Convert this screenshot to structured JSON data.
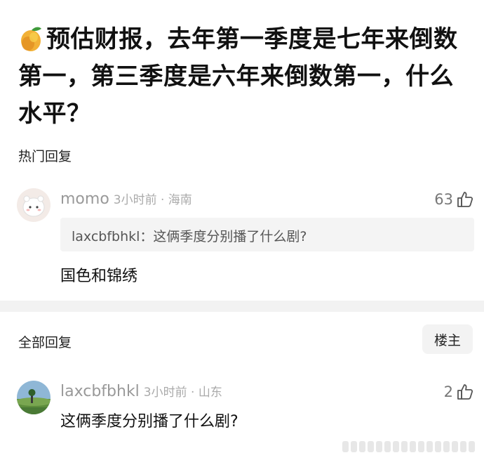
{
  "post": {
    "title": "预估财报，去年第一季度是七年来倒数第一，第三季度是六年来倒数第一，什么水平？",
    "leading_icon": "mango-emoji-icon"
  },
  "hot_replies": {
    "label": "热门回复",
    "comment": {
      "username": "momo",
      "meta": "3小时前 · 海南",
      "likes": "63",
      "quoted_user": "laxcbfbhkl：",
      "quoted_text": "这俩季度分别播了什么剧?",
      "text": "国色和锦绣"
    }
  },
  "all_replies": {
    "label": "全部回复",
    "op_badge": "楼主",
    "comment": {
      "username": "laxcbfbhkl",
      "meta": "3小时前 · 山东",
      "likes": "2",
      "text": "这俩季度分别播了什么剧?"
    }
  },
  "colors": {
    "accent": "#111111",
    "meta": "#999999",
    "quote_bg": "#f4f4f4",
    "divider": "#f2f2f2"
  }
}
